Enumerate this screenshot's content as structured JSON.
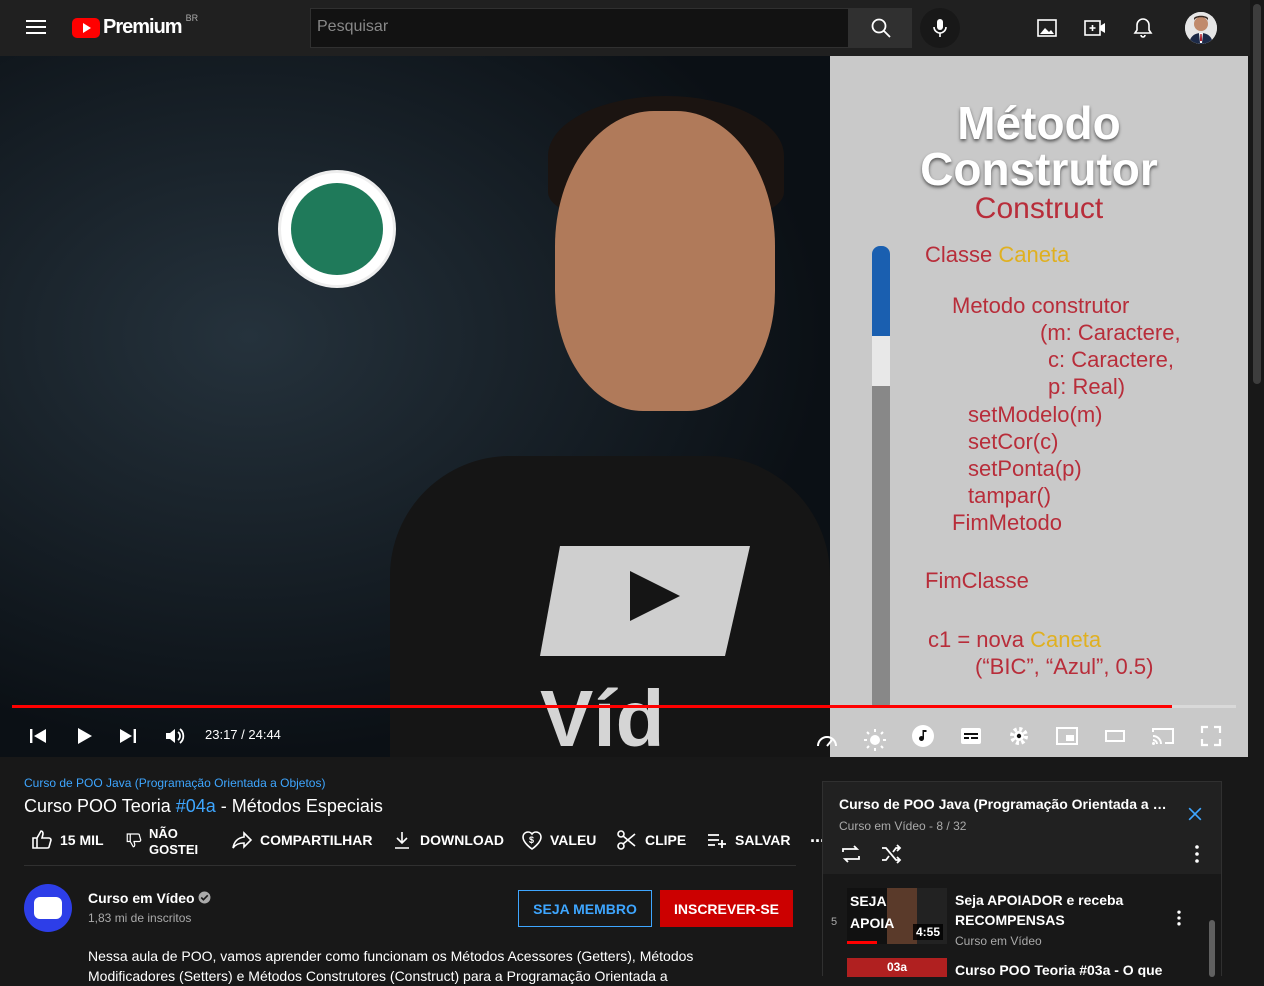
{
  "header": {
    "logo_text": "Premium",
    "country_code": "BR",
    "search_placeholder": "Pesquisar"
  },
  "slide": {
    "title_line1": "Método",
    "title_line2": "Construtor",
    "subtitle": "Construct",
    "lines": [
      {
        "a": "Classe ",
        "b": "Caneta"
      },
      {
        "a": "Metodo construtor",
        "b": ""
      },
      {
        "a": "(m: Caractere,",
        "b": ""
      },
      {
        "a": "c: Caractere,",
        "b": ""
      },
      {
        "a": "p: Real)",
        "b": ""
      },
      {
        "a": "setModelo(m)",
        "b": ""
      },
      {
        "a": "setCor(c)",
        "b": ""
      },
      {
        "a": "setPonta(p)",
        "b": ""
      },
      {
        "a": "tampar()",
        "b": ""
      },
      {
        "a": "FimMetodo",
        "b": ""
      },
      {
        "a": "FimClasse",
        "b": ""
      },
      {
        "a": "c1 = nova ",
        "b": "Caneta"
      },
      {
        "a": "(“BIC”, “Azul”, 0.5)",
        "b": ""
      }
    ]
  },
  "player": {
    "time": "23:17 / 24:44",
    "progress": 0.948
  },
  "video": {
    "playlist_link": "Curso de POO Java (Programação Orientada a Objetos)",
    "title_prefix": "Curso POO Teoria ",
    "title_tag": "#04a",
    "title_suffix": " - Métodos Especiais"
  },
  "actions": {
    "like": "15 MIL",
    "dislike_line1": "NÃO",
    "dislike_line2": "GOSTEI",
    "share": "COMPARTILHAR",
    "download": "DOWNLOAD",
    "thanks": "VALEU",
    "clip": "CLIPE",
    "save": "SALVAR",
    "more": "..."
  },
  "channel": {
    "name": "Curso em Vídeo",
    "subscribers": "1,83 mi de inscritos",
    "member_button": "SEJA MEMBRO",
    "subscribe_button": "INSCREVER-SE",
    "description": "Nessa aula de POO, vamos aprender como funcionam os Métodos Acessores (Getters), Métodos Modificadores (Setters) e Métodos Construtores (Construct) para a Programação Orientada a"
  },
  "playlist": {
    "title": "Curso de POO Java (Programação Orientada a Objetos)",
    "channel": "Curso em Vídeo",
    "position": "8 / 32",
    "items": [
      {
        "index": "5",
        "title": "Seja APOIADOR e receba RECOMPENSAS",
        "channel": "Curso em Vídeo",
        "duration": "4:55",
        "thumb_text": "SEJA APOIA"
      },
      {
        "index": "",
        "title": "Curso POO Teoria #03a - O que",
        "channel": "",
        "duration": "",
        "thumb_text": "03a"
      }
    ]
  },
  "colors": {
    "accent_red": "#ff0000",
    "link_blue": "#3ea6ff",
    "subscribe_red": "#cc0000",
    "slide_red": "#b82d3a",
    "slide_yellow": "#e0b020"
  }
}
